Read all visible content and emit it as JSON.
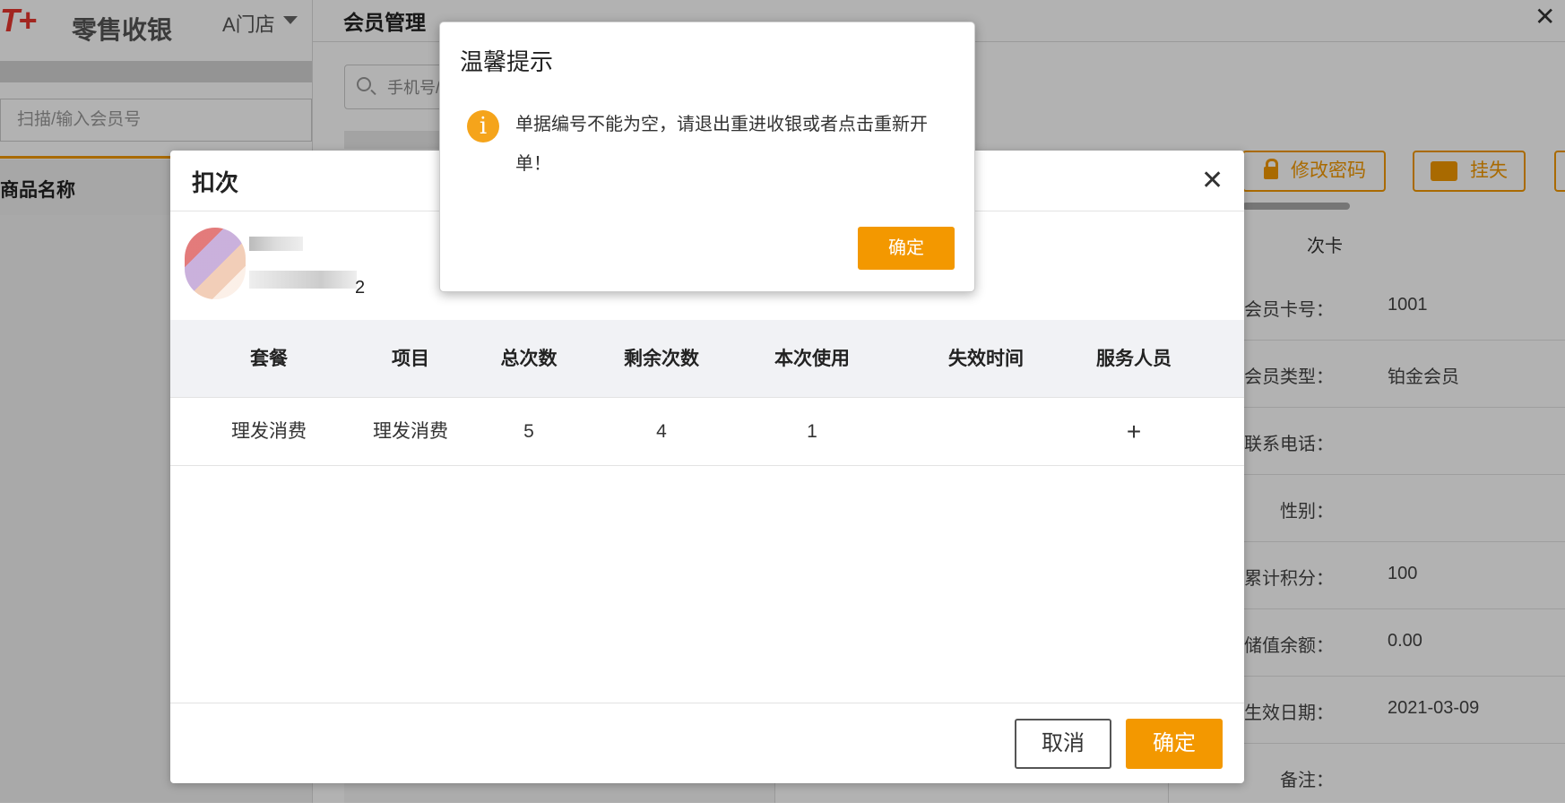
{
  "app": {
    "logo": "T+",
    "title": "零售收银",
    "store": "A门店",
    "scan_placeholder": "扫描/输入会员号",
    "product_col": "商品名称"
  },
  "member": {
    "title": "会员管理",
    "close": "✕",
    "search_placeholder": "手机号/",
    "buttons": {
      "change_password": "修改密码",
      "report_lost": "挂失"
    },
    "card_tab": "次卡",
    "info": [
      {
        "label": "会员卡号：",
        "value": "1001"
      },
      {
        "label": "会员类型：",
        "value": "铂金会员"
      },
      {
        "label": "联系电话：",
        "value": ""
      },
      {
        "label": "性别：",
        "value": ""
      },
      {
        "label": "累计积分：",
        "value": "100"
      },
      {
        "label": "储值余额：",
        "value": "0.00"
      },
      {
        "label": "生效日期：",
        "value": "2021-03-09"
      },
      {
        "label": "备注：",
        "value": ""
      }
    ]
  },
  "deduct": {
    "title": "扣次",
    "close": "✕",
    "member_suffix": "2",
    "columns": [
      "套餐",
      "项目",
      "总次数",
      "剩余次数",
      "本次使用",
      "失效时间",
      "服务人员"
    ],
    "rows": [
      {
        "package": "理发消费",
        "item": "理发消费",
        "total": "5",
        "remaining": "4",
        "use": "1",
        "expiry": "",
        "staff": "+"
      }
    ],
    "cancel": "取消",
    "confirm": "确定"
  },
  "alert": {
    "title": "温馨提示",
    "icon": "i",
    "message": "单据编号不能为空，请退出重进收银或者点击重新开单！",
    "ok": "确定"
  },
  "colors": {
    "accent": "#f39800",
    "logo_red": "#e8372f",
    "alert_icon": "#f5a41b"
  },
  "icons": {
    "search": "search-icon",
    "lock": "lock-icon",
    "card": "card-icon",
    "close": "close-icon",
    "info": "info-icon",
    "add": "plus-icon"
  }
}
